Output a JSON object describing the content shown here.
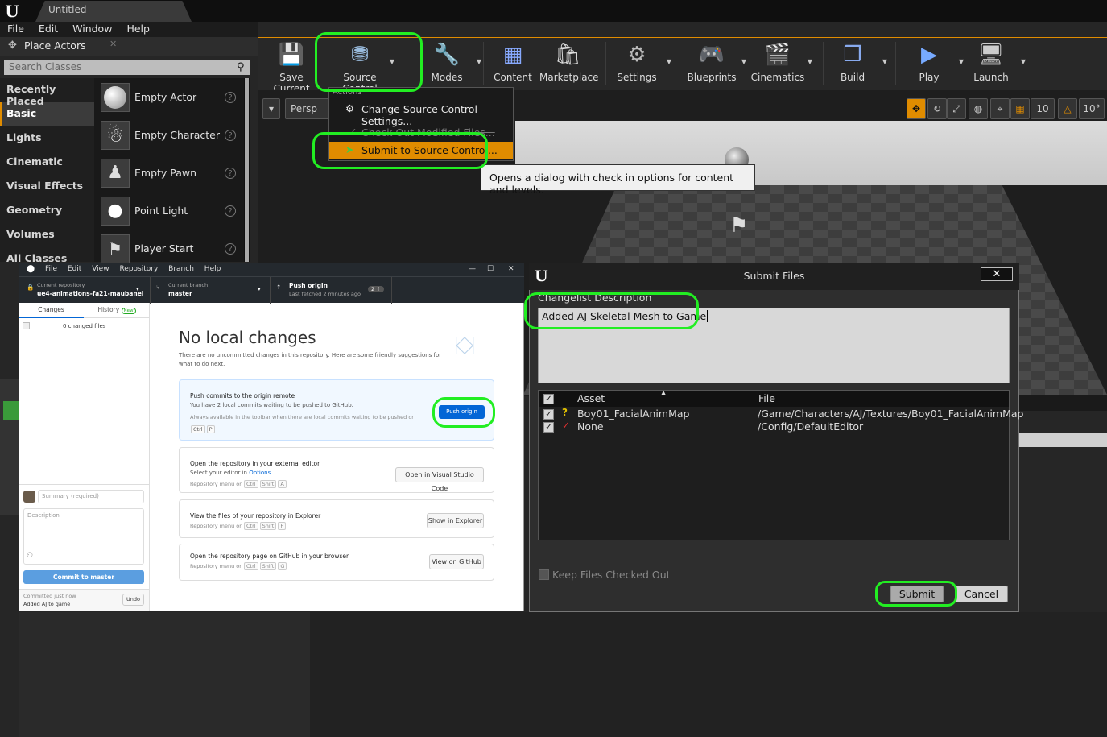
{
  "window": {
    "tab_title": "Untitled"
  },
  "menu": [
    "File",
    "Edit",
    "Window",
    "Help"
  ],
  "place_actors": {
    "title": "Place Actors",
    "search_placeholder": "Search Classes",
    "categories": [
      "Recently Placed",
      "Basic",
      "Lights",
      "Cinematic",
      "Visual Effects",
      "Geometry",
      "Volumes",
      "All Classes"
    ],
    "selected_category": "Basic",
    "items": [
      "Empty Actor",
      "Empty Character",
      "Empty Pawn",
      "Point Light",
      "Player Start"
    ]
  },
  "toolbar": {
    "buttons": [
      "Save Current",
      "Source Control",
      "Modes",
      "Content",
      "Marketplace",
      "Settings",
      "Blueprints",
      "Cinematics",
      "Build",
      "Play",
      "Launch"
    ]
  },
  "viewport": {
    "view_mode": "Persp",
    "grid_snap": "10",
    "rot_snap": "10°"
  },
  "source_menu": {
    "section": "Actions",
    "items": [
      "Change Source Control Settings...",
      "Check Out Modified Files...",
      "Submit to Source Control..."
    ],
    "tooltip": "Opens a dialog with check in options for content and levels."
  },
  "github": {
    "menu": [
      "File",
      "Edit",
      "View",
      "Repository",
      "Branch",
      "Help"
    ],
    "repo_label": "Current repository",
    "repo": "ue4-animations-fa21-maubanel",
    "branch_label": "Current branch",
    "branch": "master",
    "push_label": "Push origin",
    "push_sub": "Last fetched 2 minutes ago",
    "push_badge": "2 ↑",
    "tabs": [
      "Changes",
      "History"
    ],
    "history_badge": "New",
    "changed_files": "0 changed files",
    "heading": "No local changes",
    "subtext": "There are no uncommitted changes in this repository. Here are some friendly suggestions for what to do next.",
    "push_card": {
      "title": "Push commits to the origin remote",
      "line1": "You have 2 local commits waiting to be pushed to GitHub.",
      "line2": "Always available in the toolbar when there are local commits waiting to be pushed or",
      "keys": [
        "Ctrl",
        "P"
      ],
      "button": "Push origin"
    },
    "editor_card": {
      "title": "Open the repository in your external editor",
      "line1": "Select your editor in",
      "link": "Options",
      "line2": "Repository menu or",
      "keys": [
        "Ctrl",
        "Shift",
        "A"
      ],
      "button": "Open in Visual Studio Code"
    },
    "explorer_card": {
      "title": "View the files of your repository in Explorer",
      "line2": "Repository menu or",
      "keys": [
        "Ctrl",
        "Shift",
        "F"
      ],
      "button": "Show in Explorer"
    },
    "github_card": {
      "title": "Open the repository page on GitHub in your browser",
      "line2": "Repository menu or",
      "keys": [
        "Ctrl",
        "Shift",
        "G"
      ],
      "button": "View on GitHub"
    },
    "summary_placeholder": "Summary (required)",
    "description_placeholder": "Description",
    "commit_button": "Commit to master",
    "last_commit_time": "Committed just now",
    "last_commit_msg": "Added AJ to game",
    "undo": "Undo"
  },
  "submit": {
    "title": "Submit Files",
    "desc_label": "Changelist Description",
    "desc_value": "Added AJ Skeletal Mesh to Game",
    "col_asset": "Asset",
    "col_file": "File",
    "rows": [
      {
        "asset": "Boy01_FacialAnimMap",
        "file": "/Game/Characters/AJ/Textures/Boy01_FacialAnimMap",
        "status": "?"
      },
      {
        "asset": "None",
        "file": "/Config/DefaultEditor",
        "status": "✓"
      }
    ],
    "keep_label": "Keep Files Checked Out",
    "submit_btn": "Submit",
    "cancel_btn": "Cancel"
  }
}
